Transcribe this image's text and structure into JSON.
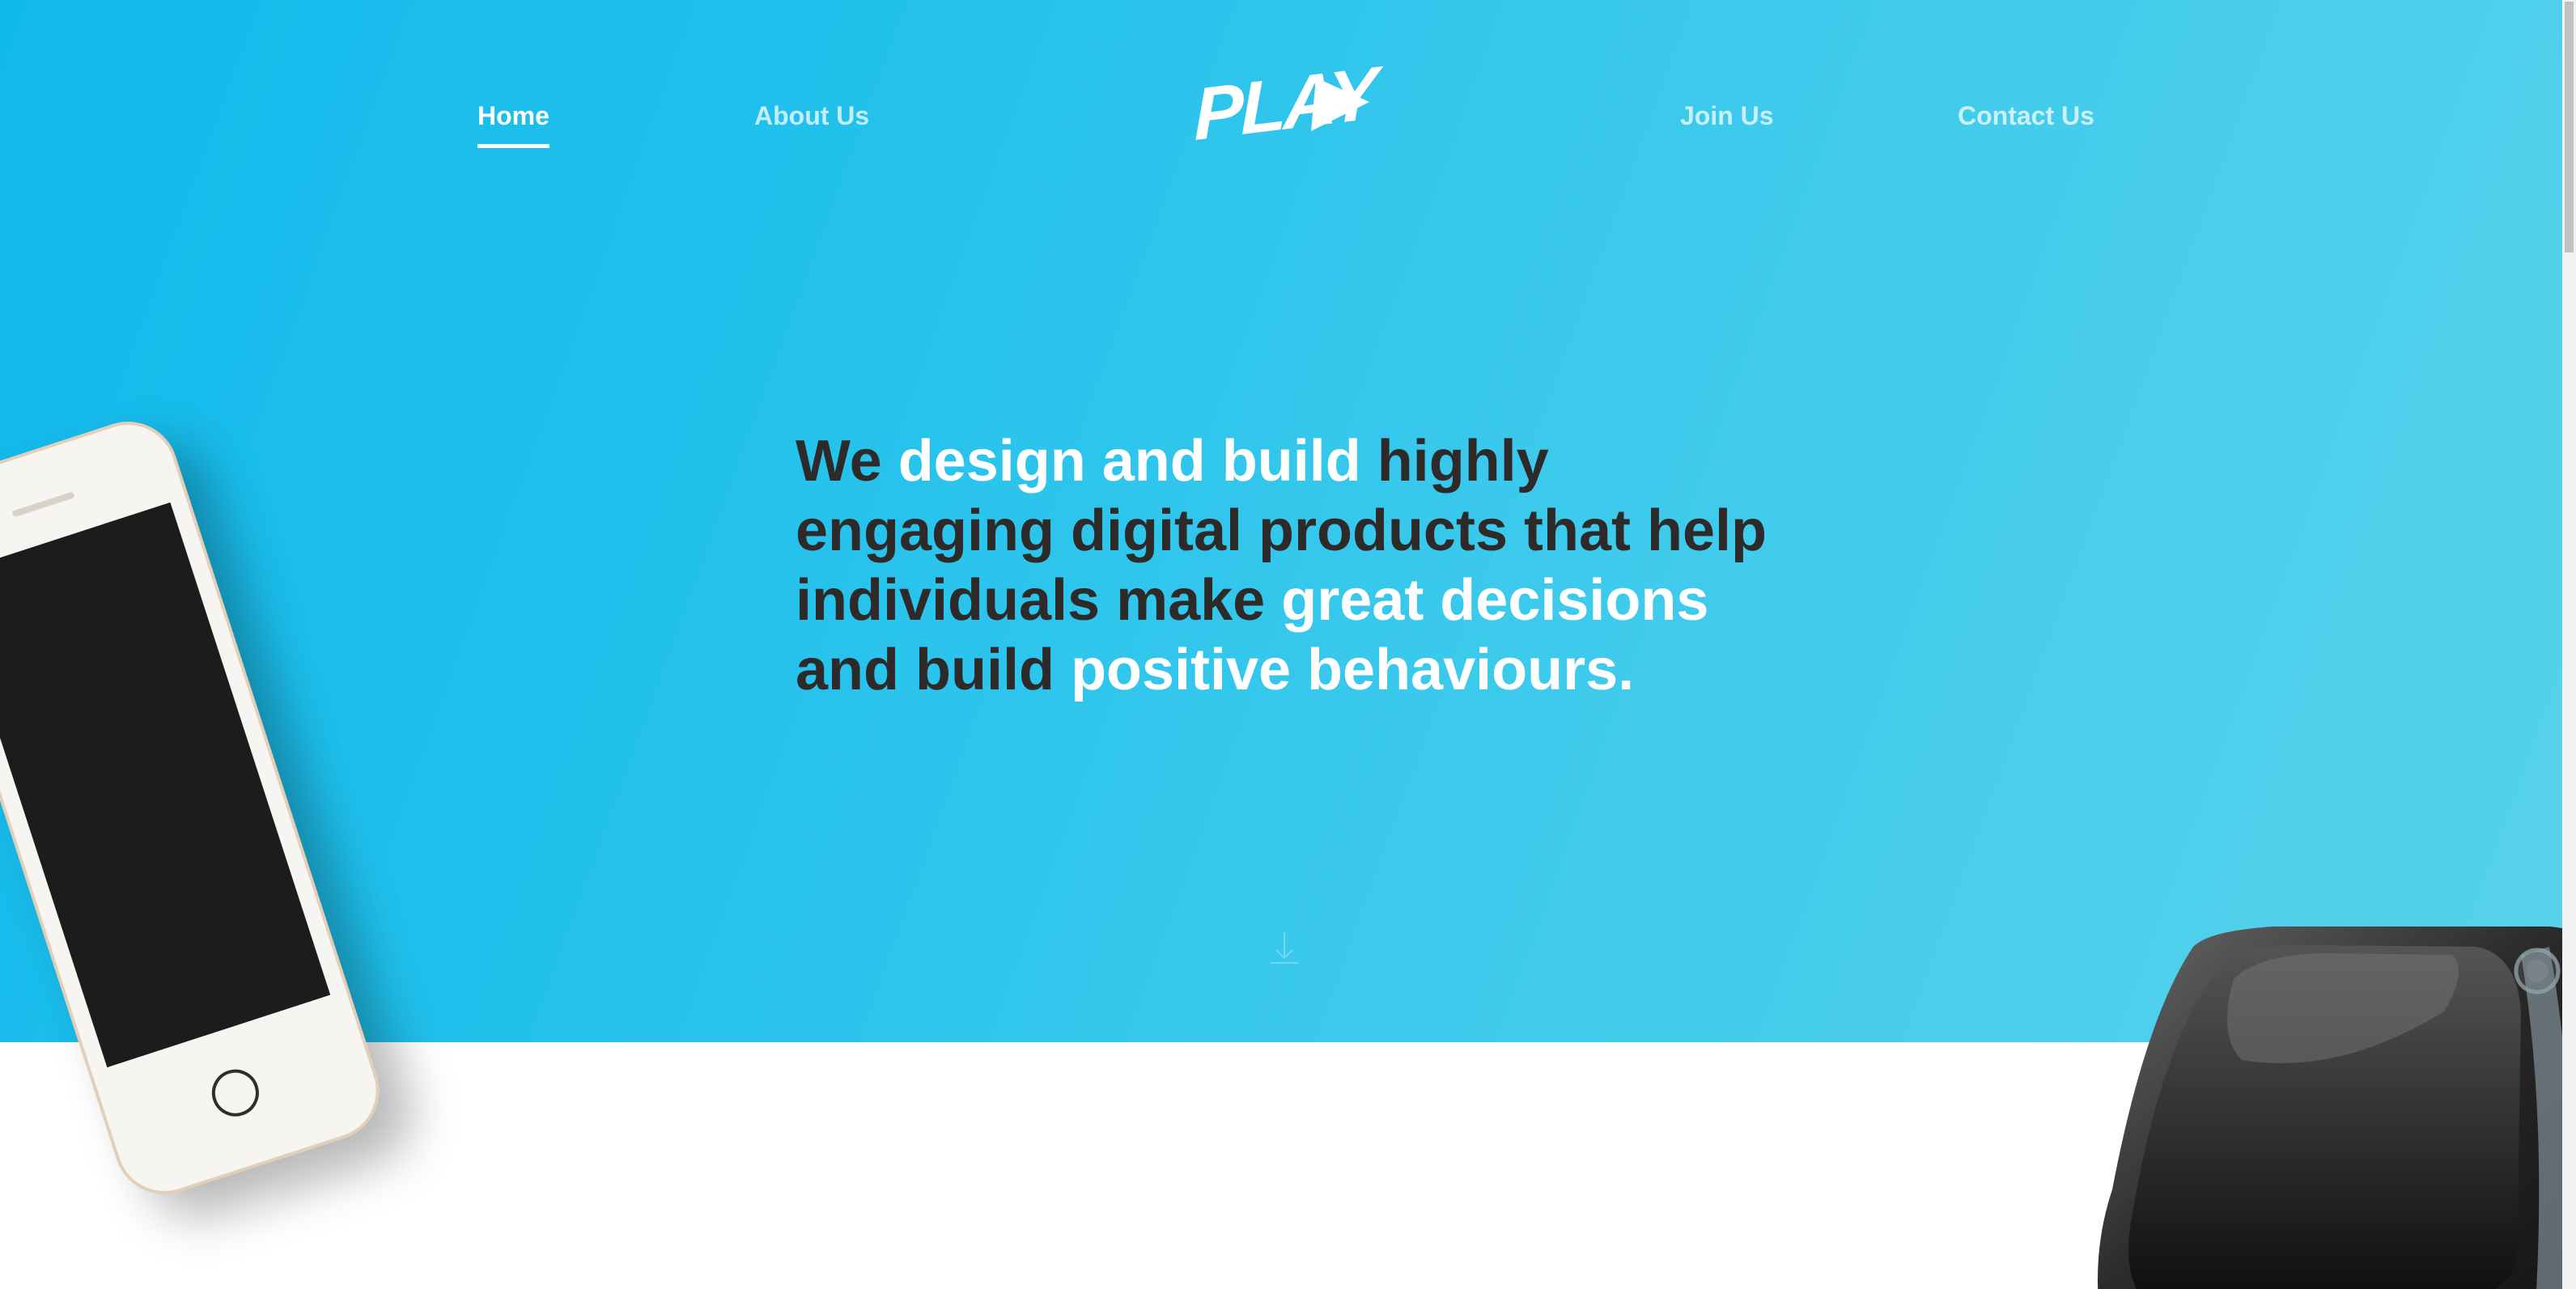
{
  "nav": {
    "home": "Home",
    "about": "About Us",
    "join": "Join Us",
    "contact": "Contact Us",
    "active": "Home"
  },
  "logo": {
    "text": "PLAY"
  },
  "hero": {
    "headline_segments": [
      {
        "text": "We ",
        "color": "dark"
      },
      {
        "text": "design and build ",
        "color": "white"
      },
      {
        "text": "highly engaging digital products that help individuals make ",
        "color": "dark"
      },
      {
        "text": "great decisions ",
        "color": "white"
      },
      {
        "text": "and build ",
        "color": "dark"
      },
      {
        "text": "positive behaviours.",
        "color": "white"
      }
    ]
  },
  "colors": {
    "hero_gradient_start": "#12b9eb",
    "hero_gradient_end": "#58d2ea",
    "headline_dark": "#2d2a29",
    "headline_light": "#ffffff"
  },
  "icons": {
    "logo": "play-triangle-icon",
    "scroll": "scroll-down-icon"
  }
}
